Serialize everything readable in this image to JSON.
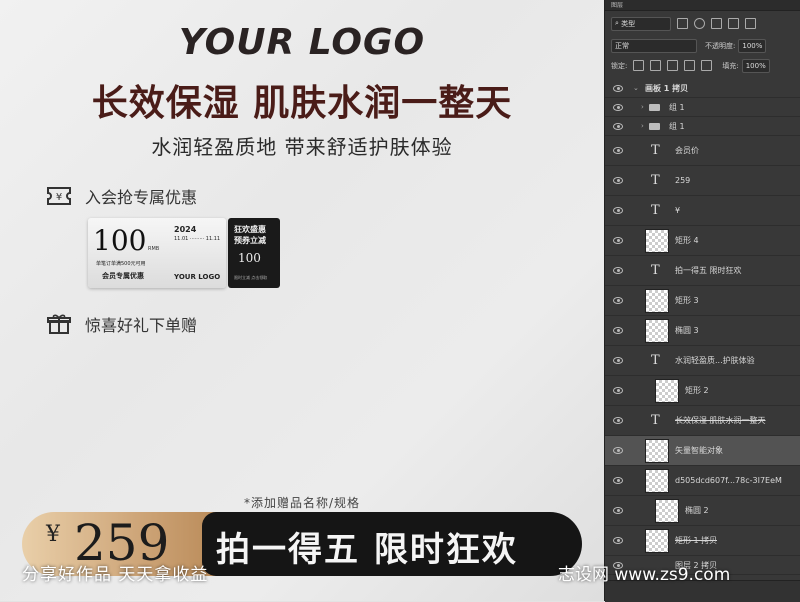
{
  "canvas": {
    "logo": "YOUR LOGO",
    "headline": "长效保湿 肌肤水润一整天",
    "subline": "水润轻盈质地 带来舒适护肤体验",
    "perk1": {
      "icon": "ticket-yen-icon",
      "label": "入会抢专属优惠"
    },
    "perk2": {
      "icon": "gift-icon",
      "label": "惊喜好礼下单赠"
    },
    "coupon": {
      "amount": "100",
      "unit": "RMB",
      "year": "2024",
      "dates": "11.01 ········· 11.11",
      "condition": "单笔订单满500元可用",
      "name": "会员专属优惠",
      "brand": "YOUR  LOGO",
      "right_line1": "狂欢盛惠",
      "right_line2": "预券立减",
      "right_amount": "100",
      "right_small": "限时立减  点击领取"
    },
    "gift_note": "*添加赠品名称/规格",
    "price_currency": "¥",
    "price": "259",
    "slogan": "拍一得五 限时狂欢"
  },
  "panel": {
    "tab": "图层",
    "filter_label": "类型",
    "blend_mode": "正常",
    "opacity_label": "不透明度:",
    "opacity_value": "100%",
    "lock_label": "锁定:",
    "fill_label": "填充:",
    "fill_value": "100%",
    "artboard": "画板 1 拷贝",
    "layers": [
      {
        "name": "组 1",
        "kind": "group"
      },
      {
        "name": "组 1",
        "kind": "group"
      },
      {
        "name": "会员价",
        "kind": "text"
      },
      {
        "name": "259",
        "kind": "text"
      },
      {
        "name": "¥",
        "kind": "text"
      },
      {
        "name": "矩形 4",
        "kind": "shape"
      },
      {
        "name": "拍一得五 限时狂欢",
        "kind": "text"
      },
      {
        "name": "矩形 3",
        "kind": "shape"
      },
      {
        "name": "椭圆 3",
        "kind": "shape"
      },
      {
        "name": "水润轻盈质...护肤体验",
        "kind": "text"
      },
      {
        "name": "矩形 2",
        "kind": "shape"
      },
      {
        "name": "长效保湿 肌肤水润一整天",
        "kind": "text"
      },
      {
        "name": "矢量智能对象",
        "kind": "smart",
        "selected": true
      },
      {
        "name": "d505dcd607f...78c-3I7EeM",
        "kind": "image"
      },
      {
        "name": "椭圆 2",
        "kind": "shape"
      },
      {
        "name": "矩形 1 拷贝",
        "kind": "shape"
      },
      {
        "name": "图层 2 拷贝",
        "kind": "image"
      }
    ]
  },
  "watermark": {
    "left": "分享好作品 天天拿收益",
    "right": "志设网 www.zs9.com"
  }
}
